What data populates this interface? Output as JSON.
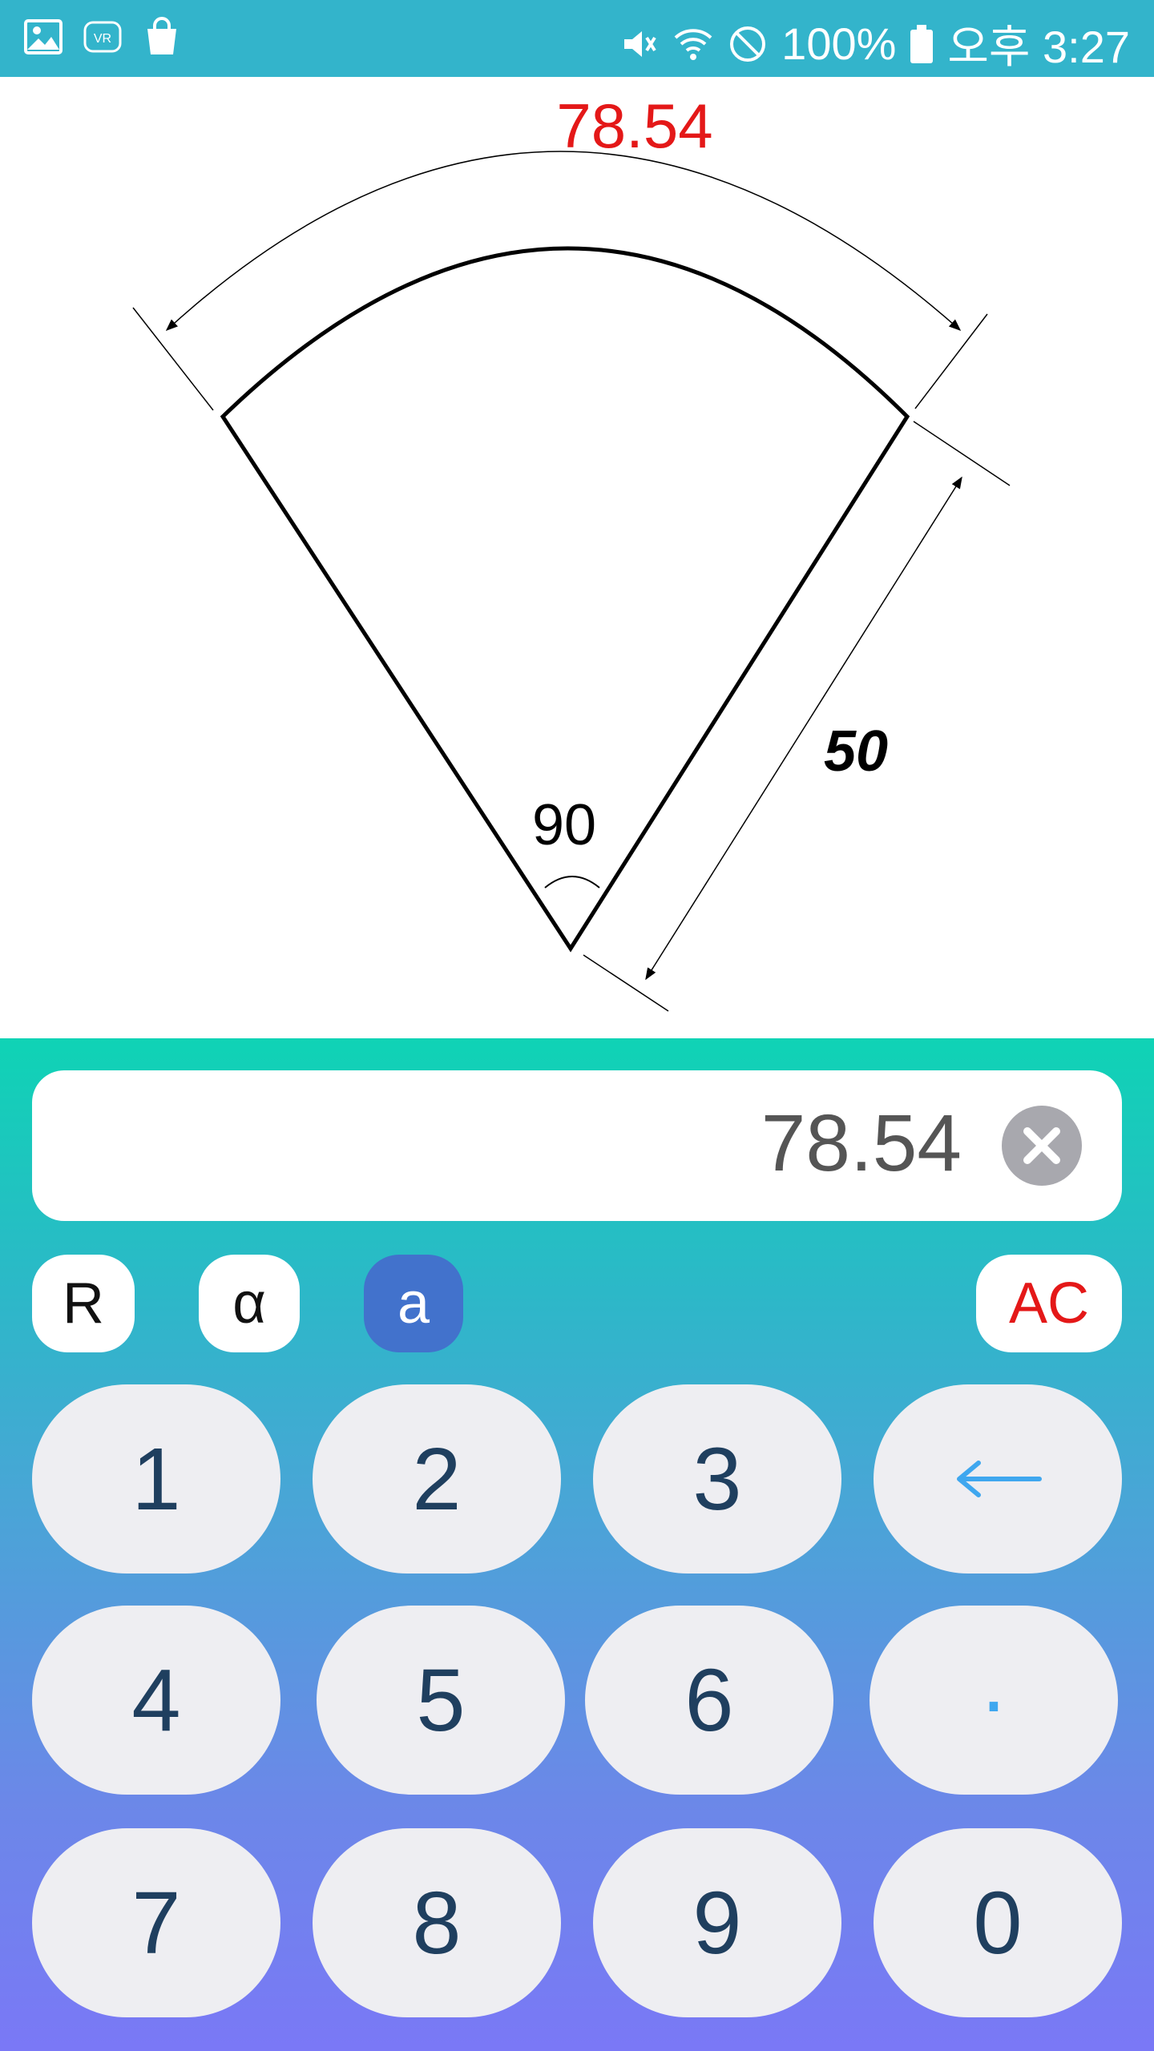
{
  "status_bar": {
    "battery": "100%",
    "time": "오후 3:27",
    "left_icons": [
      "image-icon",
      "vr-icon",
      "shopping-bag-icon"
    ],
    "right_icons": [
      "mute-icon",
      "wifi-icon",
      "do-not-disturb-icon",
      "battery-icon"
    ]
  },
  "diagram": {
    "arc_length_label": "78.54",
    "radius_label": "50",
    "angle_label": "90",
    "colors": {
      "arc_length": "#e41818",
      "lines": "#000000"
    }
  },
  "calculator": {
    "display_value": "78.54",
    "modes": [
      {
        "label": "R",
        "active": false
      },
      {
        "label": "α",
        "active": false
      },
      {
        "label": "a",
        "active": true
      }
    ],
    "ac_label": "AC",
    "keys": {
      "k1": "1",
      "k2": "2",
      "k3": "3",
      "backspace": "←",
      "k4": "4",
      "k5": "5",
      "k6": "6",
      "dot": "·",
      "k7": "7",
      "k8": "8",
      "k9": "9",
      "k0": "0"
    },
    "colors": {
      "active_mode": "#4272cc",
      "ac": "#e41818",
      "accent_key": "#3fa7ef",
      "key_text": "#1f3f5f"
    }
  }
}
